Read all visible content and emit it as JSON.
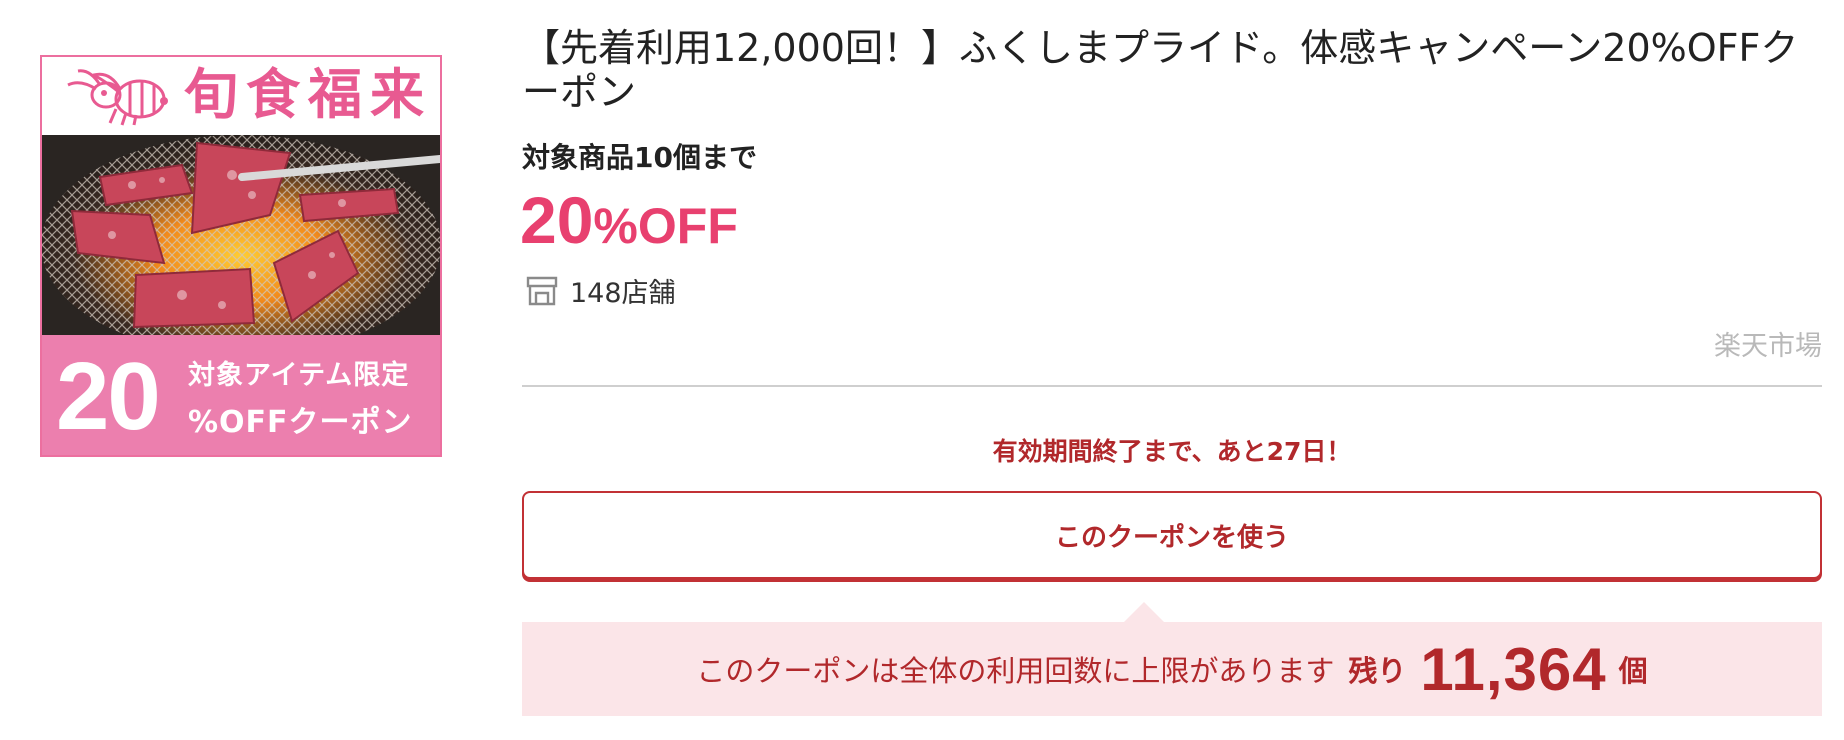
{
  "coupon": {
    "title": "【先着利用12,000回！】ふくしまプライド。体感キャンペーン20%OFFクーポン",
    "target_limit": "対象商品10個まで",
    "discount_number": "20",
    "discount_unit": "%OFF",
    "shop_count": "148店舗",
    "marketplace": "楽天市場",
    "expiry_notice": "有効期間終了まで、あと27日！",
    "use_button_label": "このクーポンを使う",
    "usage_limit_text": "このクーポンは全体の利用回数に上限があります",
    "remaining_label": "残り",
    "remaining_value": "11,364",
    "remaining_unit": "個"
  },
  "coupon_image": {
    "logo_text": "旬食福来",
    "big_number": "20",
    "line1": "対象アイテム限定",
    "line2": "%OFFクーポン"
  },
  "icons": {
    "shop": "store-icon",
    "logo": "bee-icon"
  },
  "colors": {
    "accent_pink": "#e8406f",
    "accent_red": "#b1282b",
    "banner_pink": "#ec7fae",
    "notice_bg": "#fbe5e8",
    "muted_gray": "#b9b9b9"
  }
}
